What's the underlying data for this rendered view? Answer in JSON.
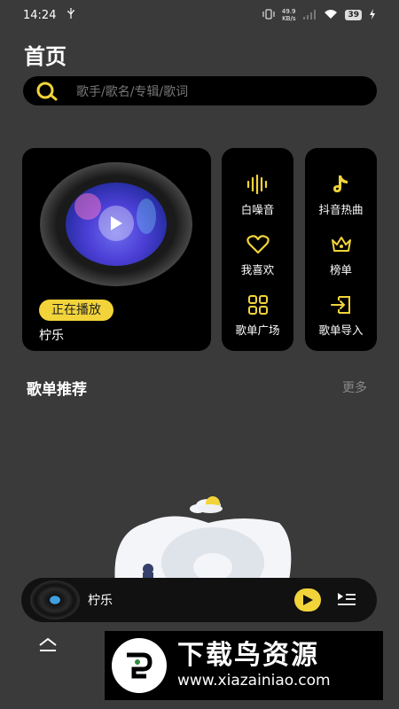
{
  "status_bar": {
    "time": "14:24",
    "net_speed_value": "49.9",
    "net_speed_unit": "KB/s",
    "battery": "39"
  },
  "page": {
    "title": "首页"
  },
  "search": {
    "placeholder": "歌手/歌名/专辑/歌词"
  },
  "now_playing": {
    "badge": "正在播放",
    "song": "柠乐"
  },
  "menu": {
    "col_a": [
      {
        "label": "白噪音",
        "icon": "sound-wave-icon"
      },
      {
        "label": "我喜欢",
        "icon": "heart-icon"
      },
      {
        "label": "歌单广场",
        "icon": "grid-icon"
      }
    ],
    "col_b": [
      {
        "label": "抖音热曲",
        "icon": "tiktok-icon"
      },
      {
        "label": "榜单",
        "icon": "crown-icon"
      },
      {
        "label": "歌单导入",
        "icon": "import-icon"
      }
    ]
  },
  "playlist_section": {
    "title": "歌单推荐",
    "more": "更多"
  },
  "mini_player": {
    "title": "柠乐"
  },
  "watermark": {
    "title": "下载鸟资源",
    "url": "www.xiazainiao.com"
  },
  "colors": {
    "accent": "#f2d43a",
    "background": "#3a3a3a",
    "card": "#000000"
  }
}
